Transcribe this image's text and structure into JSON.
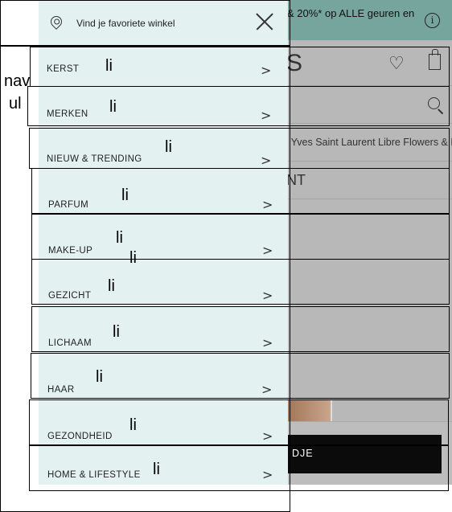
{
  "background_page": {
    "promo_text": "& 20%* op ALLE geuren en",
    "logo_fragment": "S",
    "product_text": "' Yves Saint Laurent Libre Flowers & Fl",
    "brand_fragment": "NT",
    "cart_button_fragment": "DJE"
  },
  "menu": {
    "store_finder_label": "Vind je favoriete winkel",
    "items": [
      {
        "label": "KERST"
      },
      {
        "label": "MERKEN"
      },
      {
        "label": "NIEUW & TRENDING"
      },
      {
        "label": "PARFUM"
      },
      {
        "label": "MAKE-UP"
      },
      {
        "label": "GEZICHT"
      },
      {
        "label": "LICHAAM"
      },
      {
        "label": "HAAR"
      },
      {
        "label": "GEZONDHEID"
      },
      {
        "label": "HOME & LIFESTYLE"
      }
    ],
    "chevron": ">"
  },
  "annotations": {
    "nav": "nav",
    "ul": "ul",
    "li": "li"
  }
}
